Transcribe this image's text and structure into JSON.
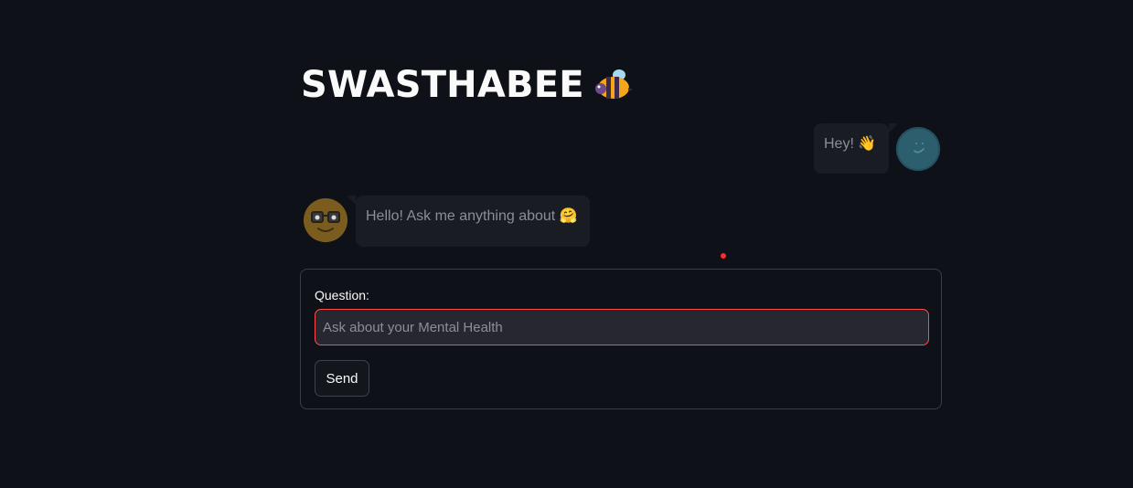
{
  "header": {
    "title": "SWASTHABEE",
    "title_emoji": "bee-icon"
  },
  "chat": {
    "messages": [
      {
        "role": "user",
        "text": "Hey! 👋",
        "avatar": "user-avatar"
      },
      {
        "role": "assistant",
        "text": "Hello! Ask me anything about 🤗",
        "avatar": "bot-avatar"
      }
    ]
  },
  "form": {
    "label": "Question:",
    "input_value": "",
    "input_placeholder": "Ask about your Mental Health",
    "send_label": "Send"
  },
  "colors": {
    "background": "#0e1117",
    "accent": "#ff4b4b",
    "bubble": "#1a1c24"
  }
}
